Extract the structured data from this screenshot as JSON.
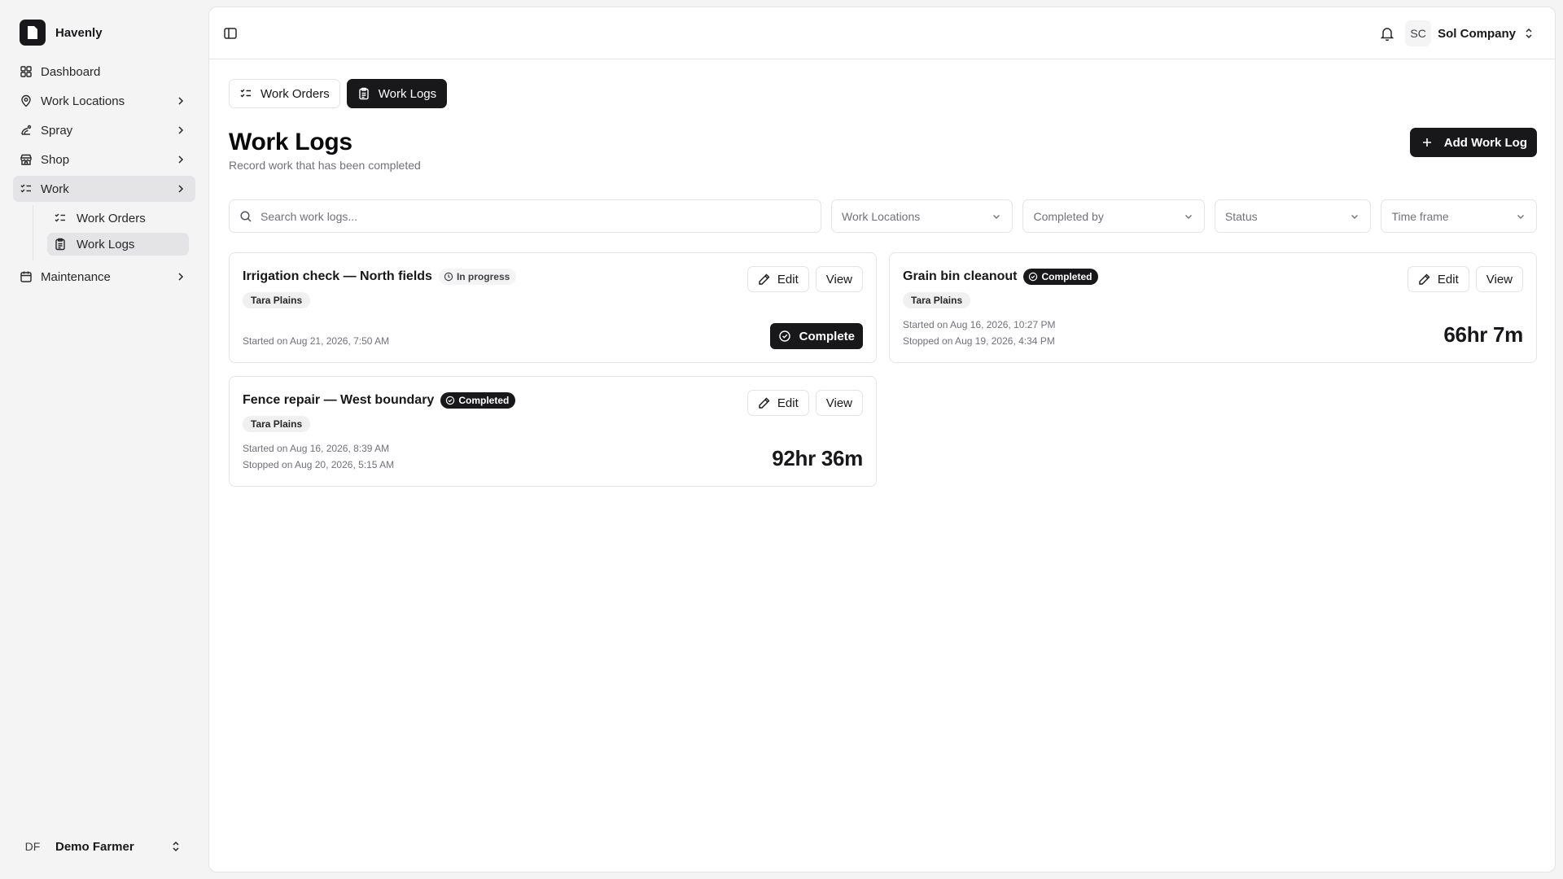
{
  "brand": {
    "name": "Havenly"
  },
  "sidebar": {
    "items": [
      {
        "label": "Dashboard"
      },
      {
        "label": "Work Locations"
      },
      {
        "label": "Spray"
      },
      {
        "label": "Shop"
      },
      {
        "label": "Work"
      },
      {
        "label": "Maintenance"
      }
    ],
    "work_sub": [
      {
        "label": "Work Orders"
      },
      {
        "label": "Work Logs"
      }
    ],
    "user": {
      "initials": "DF",
      "name": "Demo Farmer"
    }
  },
  "topbar": {
    "company_initials": "SC",
    "company_name": "Sol Company"
  },
  "tabs": [
    {
      "label": "Work Orders"
    },
    {
      "label": "Work Logs"
    }
  ],
  "page": {
    "title": "Work Logs",
    "subtitle": "Record work that has been completed",
    "add_label": "Add Work Log"
  },
  "filters": {
    "search_placeholder": "Search work logs...",
    "work_locations": "Work Locations",
    "completed_by": "Completed by",
    "status": "Status",
    "time_frame": "Time frame"
  },
  "actions": {
    "edit": "Edit",
    "view": "View",
    "complete": "Complete"
  },
  "logs": [
    {
      "title": "Irrigation check — North fields",
      "status": "In progress",
      "location": "Tara Plains",
      "started": "Started on Aug 21, 2026, 7:50 AM"
    },
    {
      "title": "Grain bin cleanout",
      "status": "Completed",
      "location": "Tara Plains",
      "started": "Started on Aug 16, 2026, 10:27 PM",
      "stopped": "Stopped on Aug 19, 2026, 4:34 PM",
      "duration": "66hr 7m"
    },
    {
      "title": "Fence repair — West boundary",
      "status": "Completed",
      "location": "Tara Plains",
      "started": "Started on Aug 16, 2026, 8:39 AM",
      "stopped": "Stopped on Aug 20, 2026, 5:15 AM",
      "duration": "92hr 36m"
    }
  ],
  "colors": {
    "primary": "#18181b",
    "border": "#e4e4e7",
    "muted": "#71717a",
    "background": "#f4f4f5"
  }
}
